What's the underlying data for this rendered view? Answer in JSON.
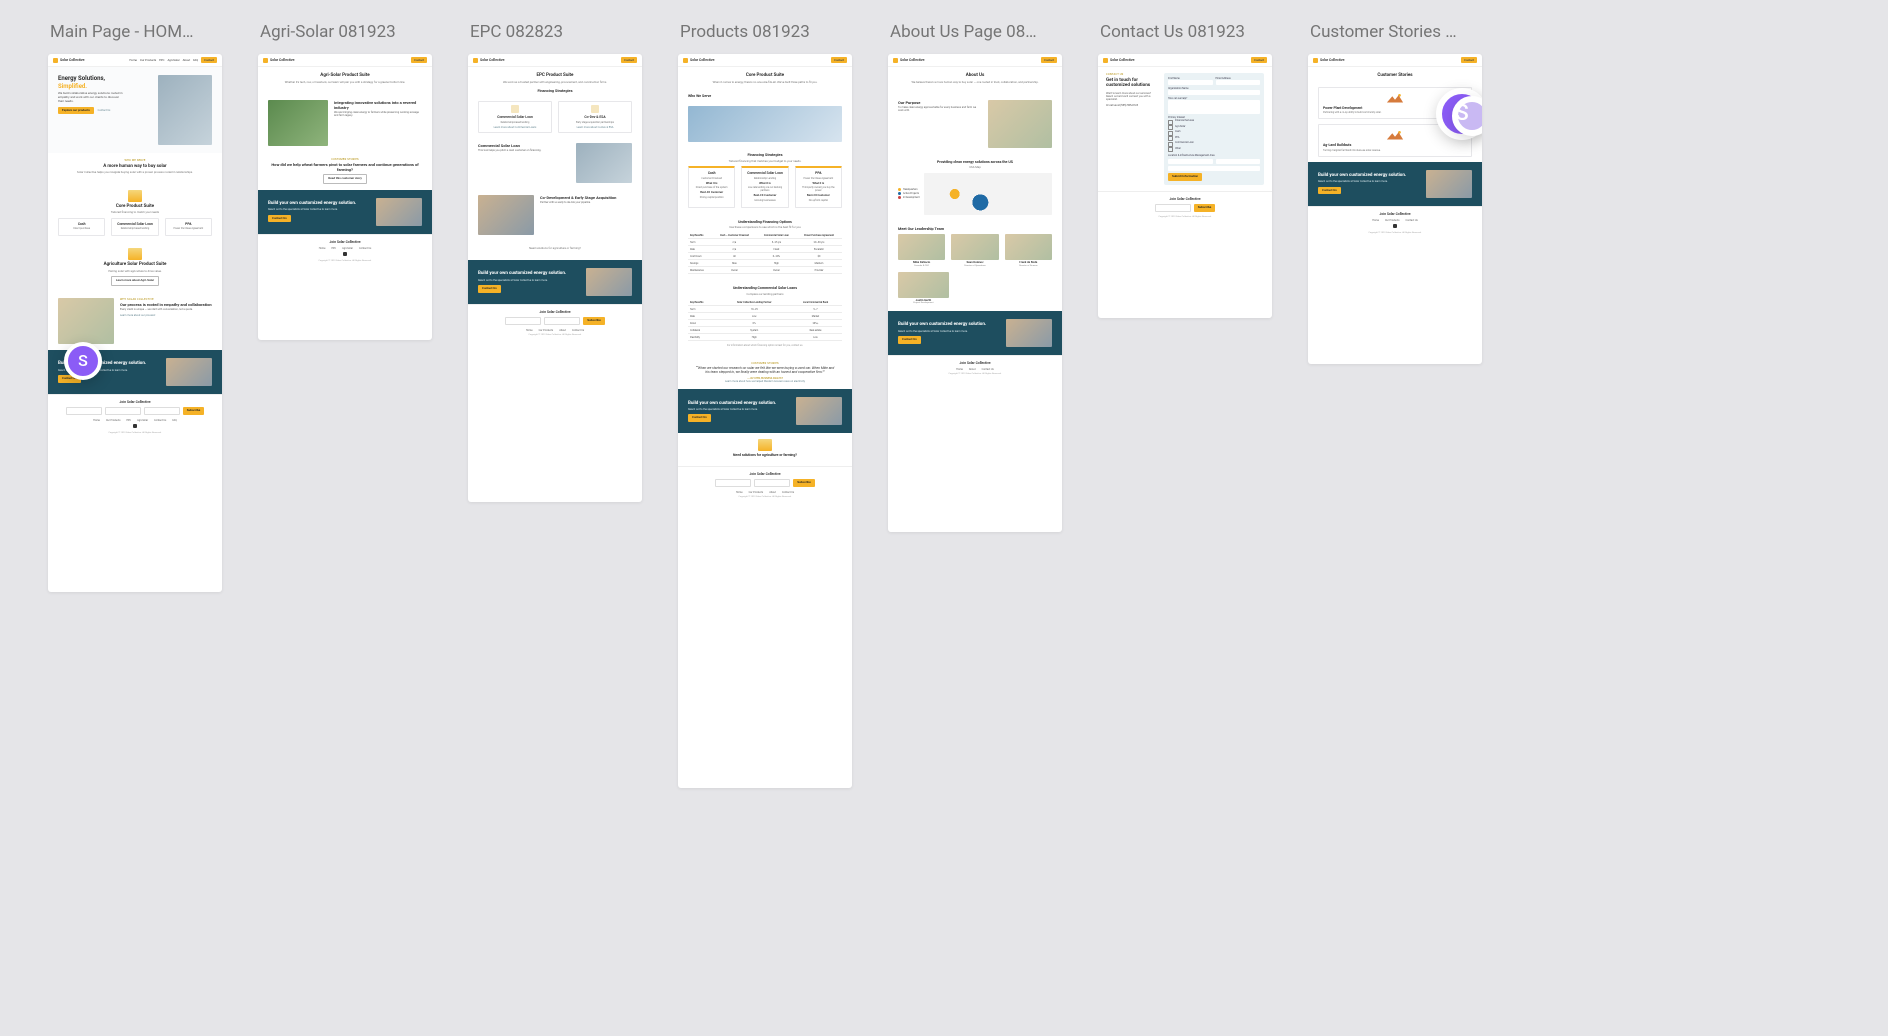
{
  "avatar_initial": "S",
  "cols": [
    {
      "title": "Main Page - HOM…"
    },
    {
      "title": "Agri-Solar 081923"
    },
    {
      "title": "EPC 082823"
    },
    {
      "title": "Products 081923"
    },
    {
      "title": "About Us Page 08…"
    },
    {
      "title": "Contact Us 081923"
    },
    {
      "title": "Customer Stories …"
    }
  ],
  "brand": "Solar Collective",
  "nav": {
    "items": [
      "Home",
      "Our Products",
      "EPC",
      "Agri-Solar",
      "About",
      "FAQ"
    ],
    "cta": "Contact"
  },
  "footer": {
    "join": "Join Solar Collective",
    "form": {
      "first": "First Name",
      "last": "Last Name",
      "email": "Email",
      "btn": "Subscribe"
    },
    "links": [
      "Home",
      "Our Products",
      "EPC",
      "Agri-Solar",
      "About",
      "Contact Us",
      "FAQ",
      "Privacy Policy"
    ],
    "copy": "Copyright © 2023 Solar Collective. All Rights Reserved."
  },
  "cta": {
    "heading": "Build your own customized energy solution.",
    "body": "Reach out to the specialists at Solar Collective to learn more.",
    "btn": "Contact Us"
  },
  "home": {
    "hero": {
      "line1": "Energy Solutions,",
      "line2": "Simplified.",
      "body": "We build collaborative energy solutions rooted in empathy and work with our clients to discover their needs.",
      "btn1": "Explore our products",
      "btn2": "Contact Us"
    },
    "s1": {
      "tag": "WHO WE SERVE",
      "h": "A more human way to buy solar",
      "p": "Solar Collective helps you navigate buying solar with a proven process rooted in relationships."
    },
    "core": {
      "h": "Core Product Suite",
      "sub": "Tailored financing to match your needs",
      "cols": [
        {
          "t": "Cash",
          "d": "Direct purchase"
        },
        {
          "t": "Commercial Solar Loan",
          "d": "Relationship based lending"
        },
        {
          "t": "PPA",
          "d": "Power Purchase Agreement"
        }
      ]
    },
    "agri": {
      "h": "Agriculture Solar Product Suite",
      "p": "Pairing solar with agriculture to drive value."
    },
    "process": {
      "tag": "WHY SOLAR COLLECTIVE",
      "h": "Our process is rooted in empathy and collaboration",
      "p": "Every client is unique — we start with conversation, not a quote.",
      "link": "Learn more about our process!"
    }
  },
  "agri": {
    "h": "Agri-Solar Product Suite",
    "intro": "Whether it's tech, row, or livestock, our team will pair you with a strategy for a greener bottom line.",
    "feat": {
      "h": "Integrating innovative solutions into a revered industry",
      "p": "We are bringing clean energy to farmers while preserving working acreage and farm legacy."
    },
    "story": {
      "tag": "CUSTOMER STORIES",
      "h": "How did we help wheat farmers pivot to solar farmers and continue generations of farming?",
      "btn": "Read this customer story"
    }
  },
  "epc": {
    "h": "EPC Product Suite",
    "intro": "We work as a trusted partner with engineering, procurement, and construction firms.",
    "fin_h": "Financing Strategies",
    "cards": [
      {
        "t": "Commercial Solar Loan",
        "d": "Relationship-based lending",
        "link": "Learn more about Commercial Loans"
      },
      {
        "t": "Co-Dev & ESA",
        "d": "Early stage acquisition partnerships",
        "link": "Learn more about Co-Dev & ESA"
      }
    ],
    "blocks": [
      {
        "h": "Commercial Solar Loan",
        "p": "This tool helps you pitch a cash customer on financing."
      },
      {
        "h": "Co-Development & Early Stage Acquisition",
        "p": "Partner with us early to de-risk your pipeline."
      }
    ],
    "closing": "Need solutions for agriculture or farming?"
  },
  "products": {
    "h": "Core Product Suite",
    "intro": "When it comes to energy, there's no one-size-fits-all. We've built three paths to fit you.",
    "who": "Who We Serve",
    "fin_h": "Financing Strategies",
    "fin_sub": "Tailored financing that matches your budget to your needs.",
    "cols": [
      {
        "name": "Cash",
        "sub": "Customer Financed",
        "what": "What it is",
        "whatd": "Direct purchase of the system",
        "fit": "Best-Fit Customer",
        "fitd": "Strong capital position"
      },
      {
        "name": "Commercial Solar Loan",
        "sub": "Relationship Lending",
        "what": "What it is",
        "whatd": "Low-rate lending via our banking partners",
        "fit": "Best-Fit Customer",
        "fitd": "Growing businesses"
      },
      {
        "name": "PPA",
        "sub": "Power Purchase Agreement",
        "what": "What it is",
        "whatd": "Third-party owned; you buy the power",
        "fit": "Best-Fit Customer",
        "fitd": "No upfront capital"
      }
    ],
    "opt": {
      "h": "Understanding Financing Options",
      "sub": "Use these comparisons to see which is the best fit for you",
      "cols": [
        "Key Benefits",
        "Cash – Customer Financed",
        "Commercial Solar Loan",
        "Power Purchase Agreement"
      ],
      "rows": [
        [
          "Term",
          "n/a",
          "5–25 yrs",
          "20–30 yrs"
        ],
        [
          "Rate",
          "n/a",
          "Fixed",
          "Escalator"
        ],
        [
          "Cost Down",
          "All",
          "0–20%",
          "$0"
        ],
        [
          "Savings",
          "Max",
          "High",
          "Medium"
        ],
        [
          "Maintenance",
          "Owner",
          "Owner",
          "Provider"
        ]
      ]
    },
    "loans": {
      "h": "Understanding Commercial Solar Loans",
      "sub": "Compare our lending partners",
      "cols": [
        "Key Benefits",
        "Solar Collective Lending Partner",
        "Local Commercial Bank"
      ],
      "rows": [
        [
          "Term",
          "10–25",
          "5–7"
        ],
        [
          "Rate",
          "Low",
          "Market"
        ],
        [
          "Down",
          "0%",
          "20%+"
        ],
        [
          "Collateral",
          "System",
          "Real estate"
        ],
        [
          "Flexibility",
          "High",
          "Low"
        ]
      ],
      "note": "For information about which financing option is best for you, contact us."
    },
    "quote": {
      "tag": "CUSTOMER STORIES",
      "q": "“When we started our research on solar we felt like we were buying a used car. When Mike and his team stepped in, we finally were dealing with an honest and cooperative firm.”",
      "who": "— JAY DYER, BUSINESS ANALYST",
      "link": "Learn more about how we helped Western Growers save on electricity"
    },
    "closing": "Need solutions for agriculture or farming?"
  },
  "about": {
    "h": "About Us",
    "intro": "We believe there's a more human way to buy solar — one rooted in trust, collaboration, and partnership.",
    "purpose": {
      "h": "Our Purpose",
      "p": "To make clean energy approachable for every business and farm we work with."
    },
    "map": {
      "h": "Providing clean energy solutions across the US",
      "sub": "USA Map",
      "legend": [
        "Headquarters",
        "Active Projects",
        "In Development"
      ]
    },
    "team": {
      "h": "Meet Our Leadership Team",
      "members": [
        {
          "n": "Mike DeSocio",
          "t": "Founder & CEO"
        },
        {
          "n": "Sean Kolenov",
          "t": "Director of Operations"
        },
        {
          "n": "Frank de Bode",
          "t": "Director of Finance"
        },
        {
          "n": "Justin Gerth",
          "t": "Project Development"
        }
      ]
    }
  },
  "contact": {
    "tag": "CONTACT US",
    "h": "Get in touch for customized solutions",
    "p": "Want to learn more about our services? Reach out and we'll connect you with a specialist.",
    "call": "Or call us at (555) 555-0123",
    "form": {
      "first": "First Name",
      "last": "Email Address",
      "org": "Organization Name",
      "help_label": "How can we help?",
      "help": "Message",
      "interest_label": "Primary Interest",
      "opts": [
        "Financial Services",
        "Agri-Solar",
        "Cash",
        "PPA",
        "Commercial Loan",
        "Other"
      ],
      "loc_label": "Location & Infrastructure Management Area",
      "addr": "Address",
      "zip": "Zip",
      "phone": "Phone",
      "btn": "Submit Information"
    }
  },
  "stories": {
    "h": "Customer Stories",
    "cards": [
      {
        "h": "Power Plant Development",
        "p": "Partnering with a co-op utility to build community solar."
      },
      {
        "h": "Ag-Land Buildouts",
        "p": "Turning marginal farmland into dual-use solar revenue."
      }
    ]
  }
}
